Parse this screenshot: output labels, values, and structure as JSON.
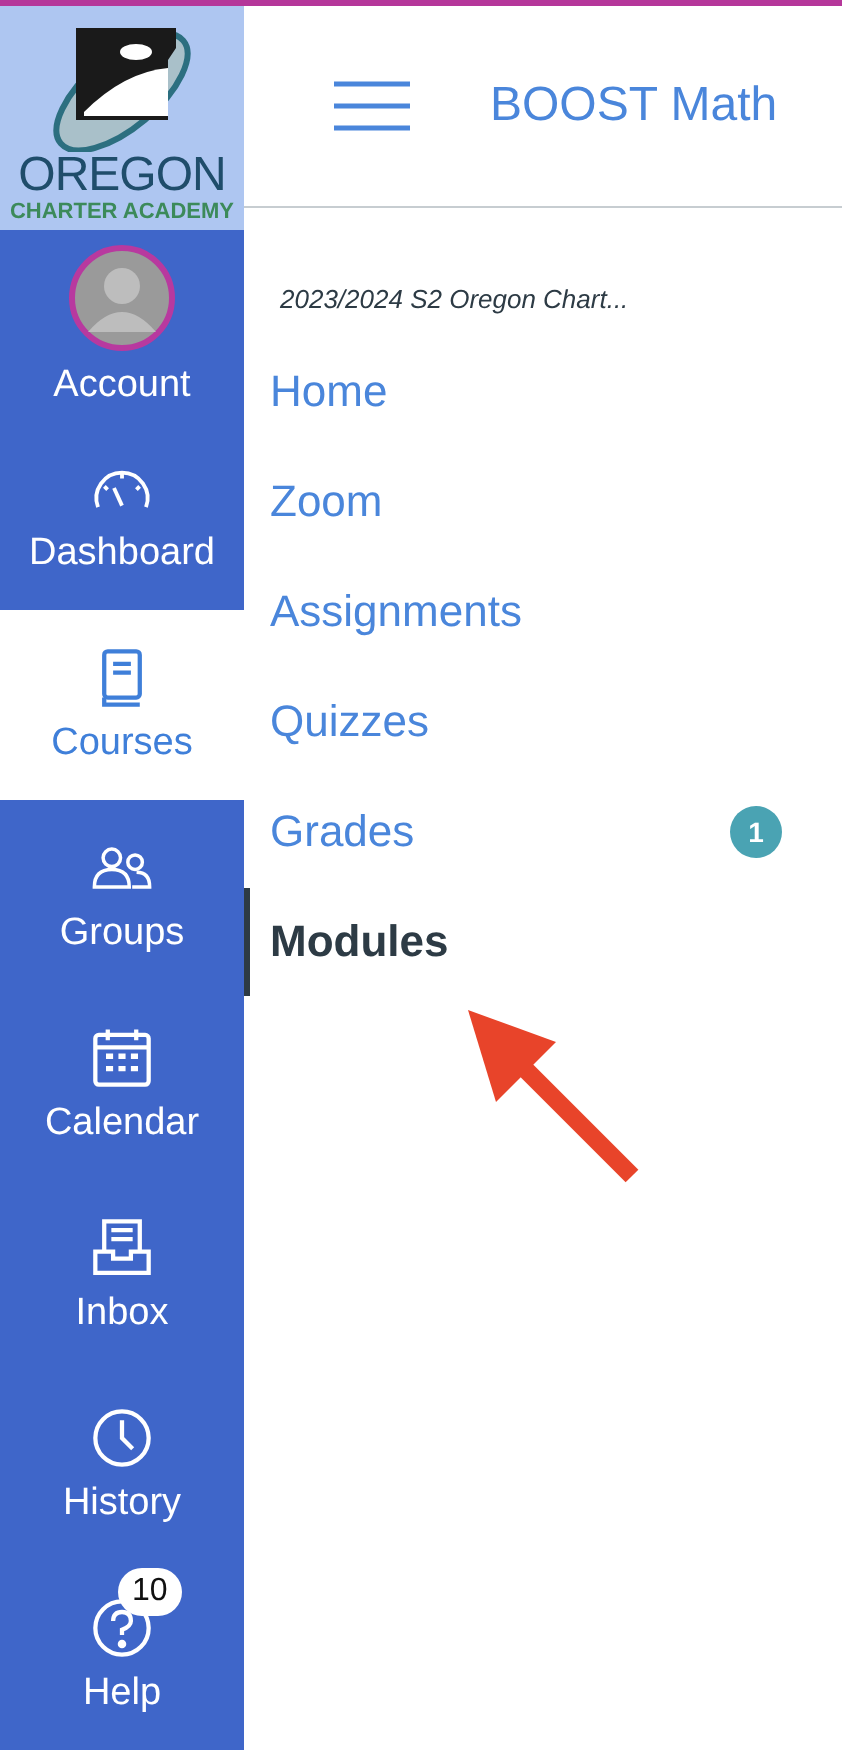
{
  "logo": {
    "line1": "OREGON",
    "line2": "CHARTER ACADEMY"
  },
  "sidebar": {
    "items": [
      {
        "kind": "account",
        "label": "Account",
        "selected": false
      },
      {
        "kind": "dashboard",
        "label": "Dashboard",
        "selected": false
      },
      {
        "kind": "courses",
        "label": "Courses",
        "selected": true
      },
      {
        "kind": "groups",
        "label": "Groups",
        "selected": false
      },
      {
        "kind": "calendar",
        "label": "Calendar",
        "selected": false
      },
      {
        "kind": "inbox",
        "label": "Inbox",
        "selected": false
      },
      {
        "kind": "history",
        "label": "History",
        "selected": false
      },
      {
        "kind": "help",
        "label": "Help",
        "selected": false,
        "badge": "10"
      }
    ]
  },
  "header": {
    "title": "BOOST Math"
  },
  "course_nav": {
    "term": "2023/2024 S2 Oregon Chart...",
    "items": [
      {
        "label": "Home",
        "selected": false
      },
      {
        "label": "Zoom",
        "selected": false
      },
      {
        "label": "Assignments",
        "selected": false
      },
      {
        "label": "Quizzes",
        "selected": false
      },
      {
        "label": "Grades",
        "selected": false,
        "badge": "1"
      },
      {
        "label": "Modules",
        "selected": true
      }
    ]
  }
}
